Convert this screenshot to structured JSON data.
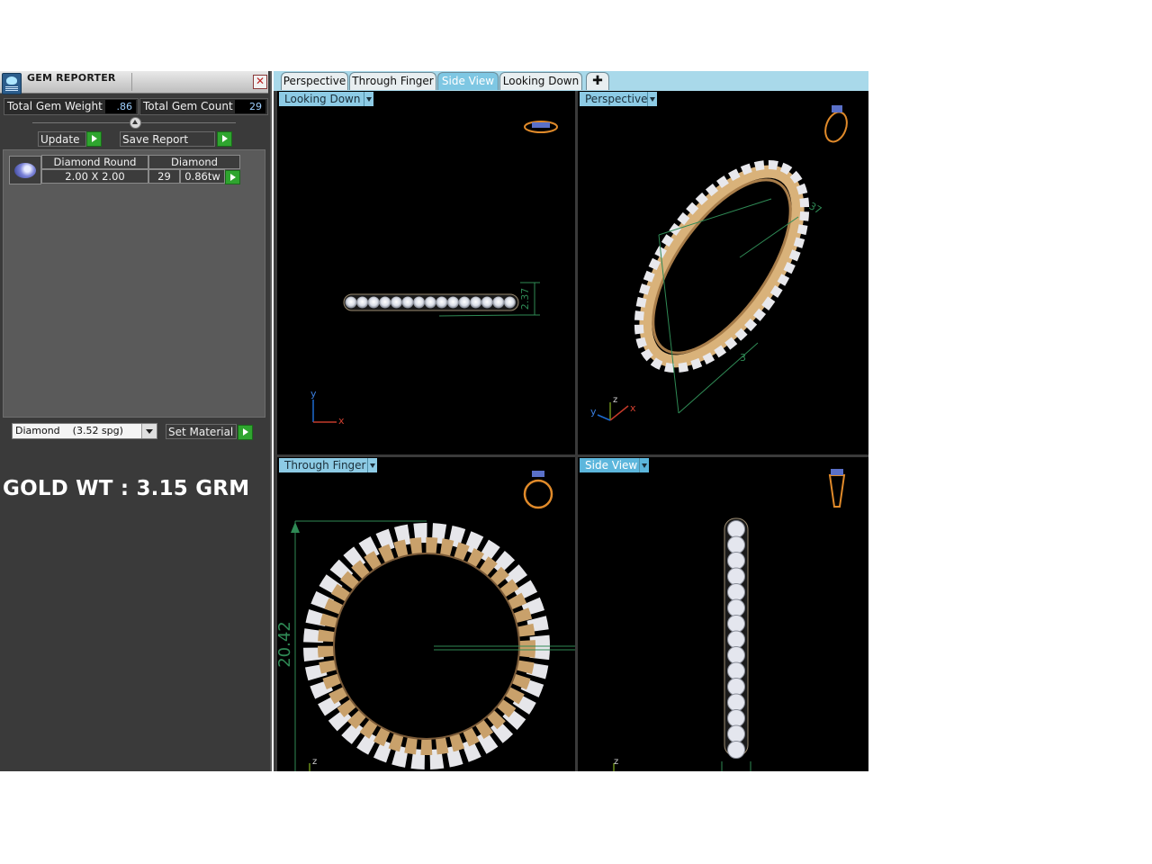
{
  "gem_reporter": {
    "title": "GEM REPORTER",
    "total_gem_weight_label": "Total Gem Weight",
    "total_gem_weight_value": ".86",
    "total_gem_count_label": "Total Gem Count",
    "total_gem_count_value": "29",
    "update_label": "Update",
    "save_report_label": "Save Report",
    "table": {
      "header_shape": "Diamond Round",
      "header_material": "Diamond",
      "size": "2.00 X 2.00",
      "count": "29",
      "weight": "0.86tw"
    },
    "material_select": "Diamond    (3.52 spg)",
    "set_material_label": "Set Material",
    "gold_weight_text": "GOLD WT : 3.15 GRM"
  },
  "tabs": [
    "Perspective",
    "Through Finger",
    "Side View",
    "Looking Down"
  ],
  "active_tab": "Side View",
  "viewports": {
    "top_left": {
      "label": "Looking Down",
      "dimension": "2.37",
      "axis_a": "y",
      "axis_b": "x"
    },
    "top_right": {
      "label": "Perspective",
      "dimension_1": "37",
      "dimension_2": "3",
      "axis_a": "z",
      "axis_b": "y",
      "axis_c": "x"
    },
    "bottom_left": {
      "label": "Through Finger",
      "dimension": "20.42",
      "axis_a": "z"
    },
    "bottom_right": {
      "label": "Side View",
      "axis_a": "z"
    }
  },
  "colors": {
    "panel_bg": "#3a3a3a",
    "tab_active": "#7ec7e3",
    "viewport_bg": "#000000",
    "gold": "#c9a16b",
    "dimension_green": "#2f8a55",
    "accent_green": "#2fa52f"
  },
  "icons": [
    "gem-reporter-app-icon",
    "close-icon",
    "collapse-arrow-icon",
    "play-arrow-icon",
    "dropdown-arrow-icon",
    "add-tab-icon"
  ]
}
